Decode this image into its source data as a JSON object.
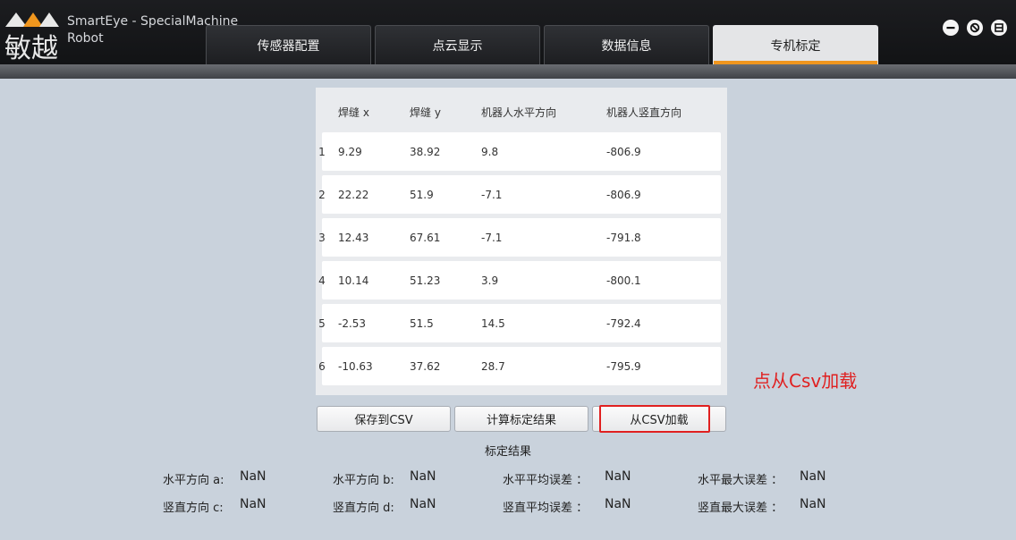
{
  "app": {
    "title_line1": "SmartEye - SpecialMachine",
    "title_line2": "Robot"
  },
  "tabs": [
    {
      "label": "传感器配置",
      "active": false
    },
    {
      "label": "点云显示",
      "active": false
    },
    {
      "label": "数据信息",
      "active": false
    },
    {
      "label": "专机标定",
      "active": true
    }
  ],
  "window_controls": [
    "minimize-icon",
    "restore-icon",
    "close-icon"
  ],
  "table": {
    "headers": [
      "焊缝 x",
      "焊缝 y",
      "机器人水平方向",
      "机器人竖直方向"
    ],
    "rows": [
      {
        "index": "1",
        "x": "9.29",
        "y": "38.92",
        "h": "9.8",
        "v": "-806.9"
      },
      {
        "index": "2",
        "x": "22.22",
        "y": "51.9",
        "h": "-7.1",
        "v": "-806.9"
      },
      {
        "index": "3",
        "x": "12.43",
        "y": "67.61",
        "h": "-7.1",
        "v": "-791.8"
      },
      {
        "index": "4",
        "x": "10.14",
        "y": "51.23",
        "h": "3.9",
        "v": "-800.1"
      },
      {
        "index": "5",
        "x": "-2.53",
        "y": "51.5",
        "h": "14.5",
        "v": "-792.4"
      },
      {
        "index": "6",
        "x": "-10.63",
        "y": "37.62",
        "h": "28.7",
        "v": "-795.9"
      }
    ]
  },
  "buttons": {
    "save_csv": "保存到CSV",
    "compute": "计算标定结果",
    "load_csv": "从CSV加载"
  },
  "annotation": "点从Csv加载",
  "results": {
    "title": "标定结果",
    "h_dir_a": {
      "label": "水平方向 a:",
      "value": "NaN"
    },
    "h_dir_b": {
      "label": "水平方向 b:",
      "value": "NaN"
    },
    "h_avg_err": {
      "label": "水平平均误差  ：",
      "value": "NaN"
    },
    "h_max_err": {
      "label": "水平最大误差  ：",
      "value": "NaN"
    },
    "v_dir_c": {
      "label": "竖直方向 c:",
      "value": "NaN"
    },
    "v_dir_d": {
      "label": "竖直方向 d:",
      "value": "NaN"
    },
    "v_avg_err": {
      "label": "竖直平均误差  ：",
      "value": "NaN"
    },
    "v_max_err": {
      "label": "竖直最大误差  ：",
      "value": "NaN"
    }
  },
  "colors": {
    "accent": "#f0961e",
    "annotation": "#e02020",
    "background": "#c9d2dc"
  }
}
